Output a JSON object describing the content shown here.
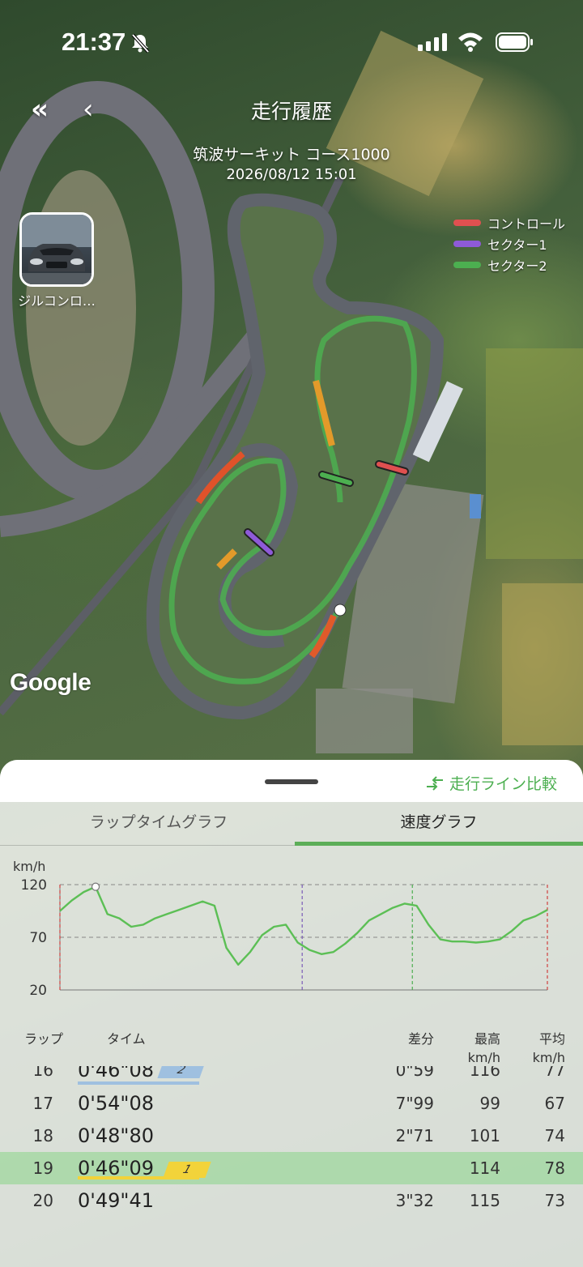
{
  "status_bar": {
    "time": "21:37"
  },
  "header": {
    "title": "走行履歴",
    "course": "筑波サーキット コース1000",
    "datetime": "2026/08/12 15:01"
  },
  "map": {
    "attribution": "Google"
  },
  "legend": [
    {
      "label": "コントロール",
      "color": "#e05050"
    },
    {
      "label": "セクター1",
      "color": "#8e5ad8"
    },
    {
      "label": "セクター2",
      "color": "#4caf50"
    }
  ],
  "car": {
    "name": "ジルコンロ…"
  },
  "sheet": {
    "compare_label": "走行ライン比較",
    "tabs": [
      {
        "label": "ラップタイムグラフ",
        "active": false
      },
      {
        "label": "速度グラフ",
        "active": true
      }
    ]
  },
  "chart_data": {
    "type": "line",
    "ylabel": "km/h",
    "y_ticks": [
      "120",
      "70",
      "20"
    ],
    "ylim": [
      20,
      120
    ],
    "series": [
      {
        "color": "#5cbf55",
        "values": [
          95,
          105,
          113,
          118,
          92,
          88,
          80,
          82,
          88,
          92,
          96,
          100,
          104,
          100,
          60,
          44,
          56,
          72,
          80,
          82,
          65,
          58,
          54,
          56,
          64,
          74,
          86,
          92,
          98,
          102,
          100,
          82,
          68,
          66,
          66,
          65,
          66,
          68,
          76,
          86,
          90,
          96
        ]
      }
    ],
    "sector_marks": [
      {
        "position": 0.0,
        "color": "#d04040"
      },
      {
        "position": 0.497,
        "color": "#7a5ab8"
      },
      {
        "position": 0.723,
        "color": "#4caf50"
      },
      {
        "position": 1.0,
        "color": "#d04040"
      }
    ],
    "grid": true
  },
  "table": {
    "headers": {
      "lap": "ラップ",
      "time": "タイム",
      "diff": "差分",
      "max": "最高",
      "max_unit": "km/h",
      "avg": "平均",
      "avg_unit": "km/h"
    },
    "rows": [
      {
        "lap": "16",
        "time": "0'46\"08",
        "diff": "0\"59",
        "max": "116",
        "avg": "77",
        "rank": "2"
      },
      {
        "lap": "17",
        "time": "0'54\"08",
        "diff": "7\"99",
        "max": "99",
        "avg": "67"
      },
      {
        "lap": "18",
        "time": "0'48\"80",
        "diff": "2\"71",
        "max": "101",
        "avg": "74"
      },
      {
        "lap": "19",
        "time": "0'46\"09",
        "diff": "",
        "max": "114",
        "avg": "78",
        "rank": "1",
        "best": true
      },
      {
        "lap": "20",
        "time": "0'49\"41",
        "diff": "3\"32",
        "max": "115",
        "avg": "73"
      }
    ]
  }
}
